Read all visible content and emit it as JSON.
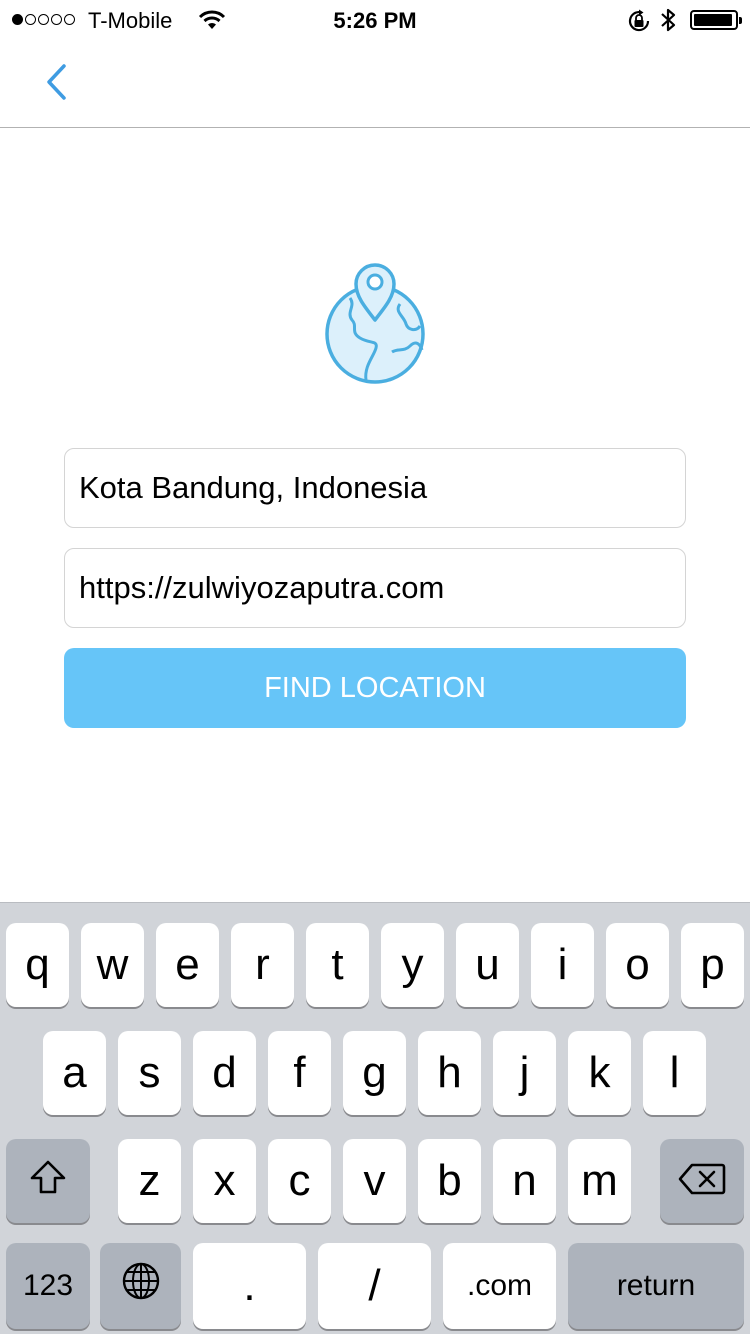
{
  "status_bar": {
    "carrier": "T-Mobile",
    "time": "5:26 PM",
    "signal_bars_filled": 1,
    "signal_bars_total": 5,
    "battery_level": 0.9
  },
  "nav": {
    "back_icon": "chevron-left-icon"
  },
  "illustration": {
    "icon": "globe-location-pin-icon",
    "color": "#4aaee0",
    "fill": "#dcf0fb"
  },
  "form": {
    "location_value": "Kota Bandung, Indonesia",
    "website_value": "https://zulwiyozaputra.com",
    "find_button_label": "FIND LOCATION",
    "button_color": "#66c5f8"
  },
  "keyboard": {
    "row1": [
      "q",
      "w",
      "e",
      "r",
      "t",
      "y",
      "u",
      "i",
      "o",
      "p"
    ],
    "row2": [
      "a",
      "s",
      "d",
      "f",
      "g",
      "h",
      "j",
      "k",
      "l"
    ],
    "row3": [
      "z",
      "x",
      "c",
      "v",
      "b",
      "n",
      "m"
    ],
    "shift_icon": "shift-arrow-icon",
    "delete_icon": "backspace-icon",
    "numbers_label": "123",
    "globe_icon": "globe-icon",
    "period_label": ".",
    "slash_label": "/",
    "dotcom_label": ".com",
    "return_label": "return"
  }
}
